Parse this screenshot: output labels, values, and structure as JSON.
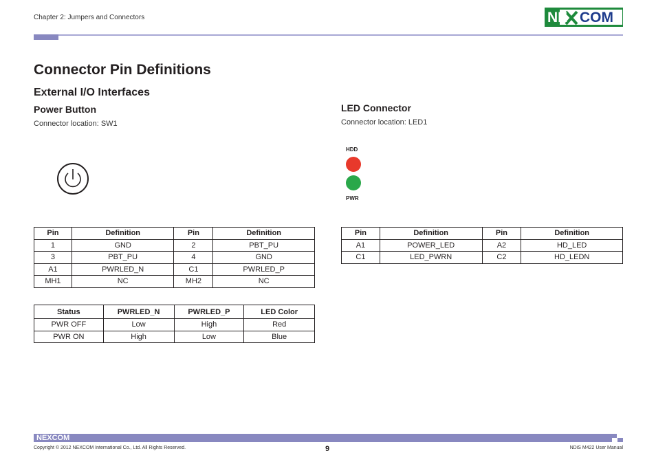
{
  "header": {
    "chapter": "Chapter 2: Jumpers and Connectors",
    "logo_text": "NEXCOM"
  },
  "page_title": "Connector Pin Definitions",
  "section_title": "External I/O Interfaces",
  "power_button": {
    "title": "Power Button",
    "location": "Connector location: SW1",
    "icon": "power-symbol-icon",
    "pin_table": {
      "headers": [
        "Pin",
        "Definition",
        "Pin",
        "Definition"
      ],
      "rows": [
        [
          "1",
          "GND",
          "2",
          "PBT_PU"
        ],
        [
          "3",
          "PBT_PU",
          "4",
          "GND"
        ],
        [
          "A1",
          "PWRLED_N",
          "C1",
          "PWRLED_P"
        ],
        [
          "MH1",
          "NC",
          "MH2",
          "NC"
        ]
      ]
    },
    "status_table": {
      "headers": [
        "Status",
        "PWRLED_N",
        "PWRLED_P",
        "LED Color"
      ],
      "rows": [
        [
          "PWR OFF",
          "Low",
          "High",
          "Red"
        ],
        [
          "PWR ON",
          "High",
          "Low",
          "Blue"
        ]
      ]
    }
  },
  "led_connector": {
    "title": "LED Connector",
    "location": "Connector location: LED1",
    "hdd_label": "HDD",
    "pwr_label": "PWR",
    "hdd_color": "#e8392b",
    "pwr_color": "#2aa84a",
    "pin_table": {
      "headers": [
        "Pin",
        "Definition",
        "Pin",
        "Definition"
      ],
      "rows": [
        [
          "A1",
          "POWER_LED",
          "A2",
          "HD_LED"
        ],
        [
          "C1",
          "LED_PWRN",
          "C2",
          "HD_LEDN"
        ]
      ]
    }
  },
  "footer": {
    "logo_text": "NEXCOM",
    "copyright": "Copyright © 2012 NEXCOM International Co., Ltd. All Rights Reserved.",
    "page_number": "9",
    "manual_name": "NDiS M422 User Manual"
  },
  "colors": {
    "brand_green": "#1e8a3c",
    "brand_blue": "#1e3b8c",
    "accent_bar": "#8888c0"
  }
}
